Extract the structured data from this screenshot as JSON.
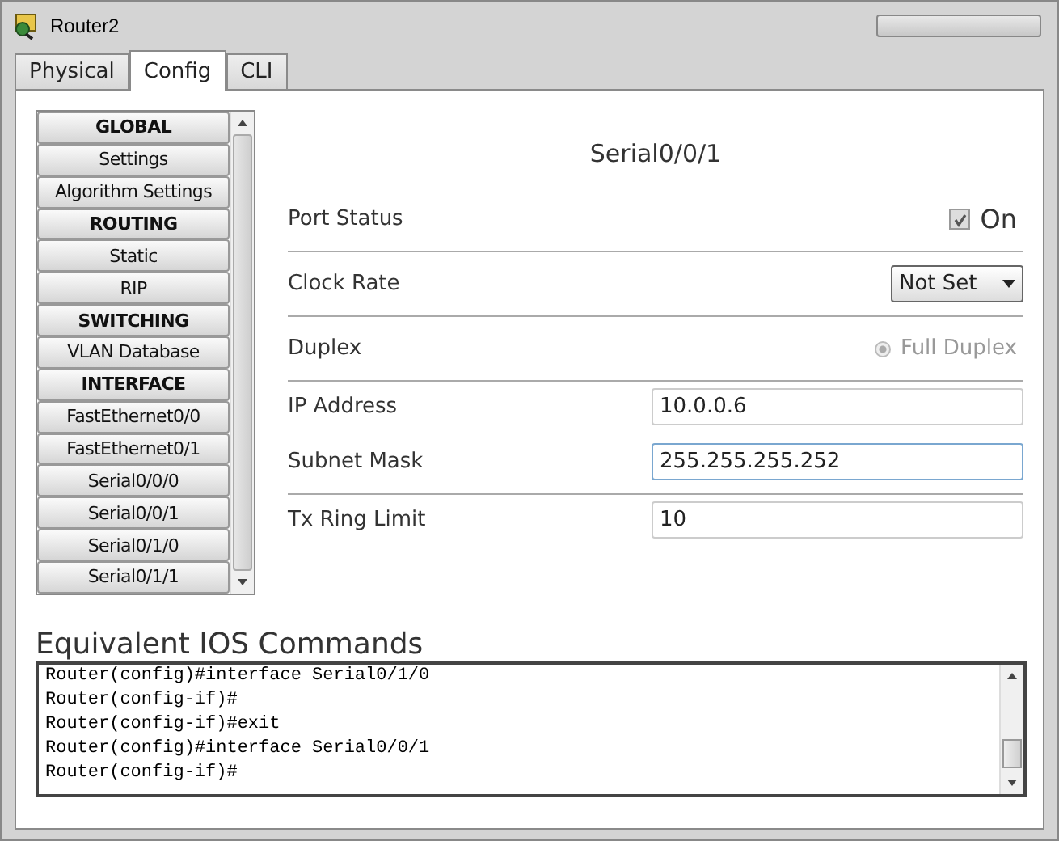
{
  "window": {
    "title": "Router2"
  },
  "tabs": [
    {
      "label": "Physical",
      "selected": false
    },
    {
      "label": "Config",
      "selected": true
    },
    {
      "label": "CLI",
      "selected": false
    }
  ],
  "sidebar": {
    "items": [
      {
        "label": "GLOBAL",
        "kind": "header"
      },
      {
        "label": "Settings",
        "kind": "item"
      },
      {
        "label": "Algorithm Settings",
        "kind": "item"
      },
      {
        "label": "ROUTING",
        "kind": "header"
      },
      {
        "label": "Static",
        "kind": "item"
      },
      {
        "label": "RIP",
        "kind": "item"
      },
      {
        "label": "SWITCHING",
        "kind": "header"
      },
      {
        "label": "VLAN Database",
        "kind": "item"
      },
      {
        "label": "INTERFACE",
        "kind": "header"
      },
      {
        "label": "FastEthernet0/0",
        "kind": "item"
      },
      {
        "label": "FastEthernet0/1",
        "kind": "item"
      },
      {
        "label": "Serial0/0/0",
        "kind": "item"
      },
      {
        "label": "Serial0/0/1",
        "kind": "item"
      },
      {
        "label": "Serial0/1/0",
        "kind": "item"
      },
      {
        "label": "Serial0/1/1",
        "kind": "item"
      }
    ]
  },
  "panel": {
    "title": "Serial0/0/1",
    "port_status": {
      "label": "Port Status",
      "checkbox_label": "On",
      "checked": true
    },
    "clock_rate": {
      "label": "Clock Rate",
      "value": "Not Set"
    },
    "duplex": {
      "label": "Duplex",
      "option_label": "Full Duplex",
      "selected": true,
      "disabled": true
    },
    "ip_address": {
      "label": "IP Address",
      "value": "10.0.0.6",
      "focused": false
    },
    "subnet_mask": {
      "label": "Subnet Mask",
      "value": "255.255.255.252",
      "focused": true
    },
    "tx_ring_limit": {
      "label": "Tx Ring Limit",
      "value": "10",
      "focused": false
    }
  },
  "ios_commands": {
    "title": "Equivalent IOS Commands",
    "lines": [
      "Router(config)#interface Serial0/1/0",
      "Router(config-if)#",
      "Router(config-if)#exit",
      "Router(config)#interface Serial0/0/1",
      "Router(config-if)#"
    ]
  }
}
